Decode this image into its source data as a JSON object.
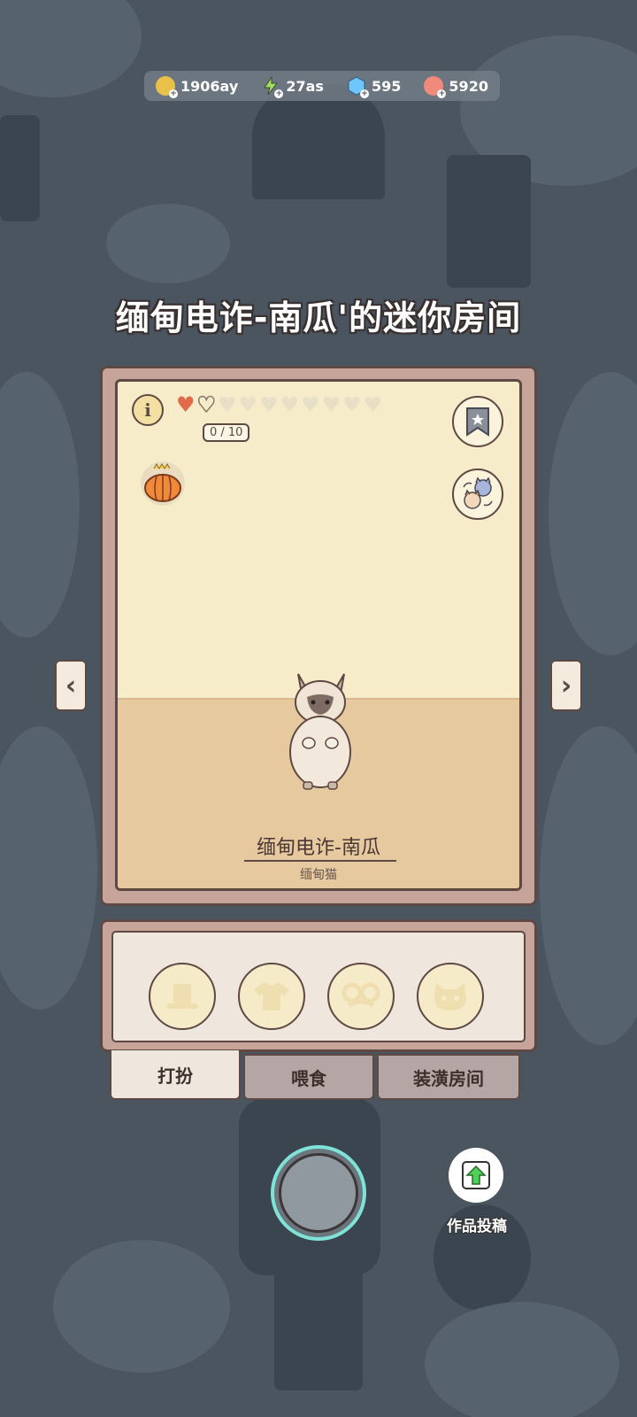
{
  "currencies": [
    {
      "icon": "coin-icon",
      "value": "1906ay",
      "color": "#e8c04a"
    },
    {
      "icon": "lightning-icon",
      "value": "27as",
      "color": "#9fe060"
    },
    {
      "icon": "diamond-icon",
      "value": "595",
      "color": "#6ec6ff"
    },
    {
      "icon": "paw-token-icon",
      "value": "5920",
      "color": "#f08a7a"
    }
  ],
  "room": {
    "title": "缅甸电诈-南瓜'的迷你房间",
    "info_label": "i",
    "affection": {
      "current": 1,
      "max": 10,
      "text": "0 / 10"
    },
    "cat_name": "缅甸电诈-南瓜",
    "cat_breed": "缅甸猫"
  },
  "nav": {
    "prev": "‹",
    "next": "›"
  },
  "actions": {
    "slots": [
      "hat-icon",
      "shirt-icon",
      "glasses-icon",
      "mask-icon"
    ],
    "tabs": [
      {
        "label": "打扮",
        "active": true
      },
      {
        "label": "喂食",
        "active": false
      },
      {
        "label": "装潢房间",
        "active": false
      }
    ]
  },
  "submit": {
    "label": "作品投稿"
  },
  "colors": {
    "frame": "#c7a49a",
    "outline": "#5e4843",
    "wall": "#f6ecca",
    "floor": "#e6c99e",
    "camera_ring": "#7fe3d8"
  }
}
